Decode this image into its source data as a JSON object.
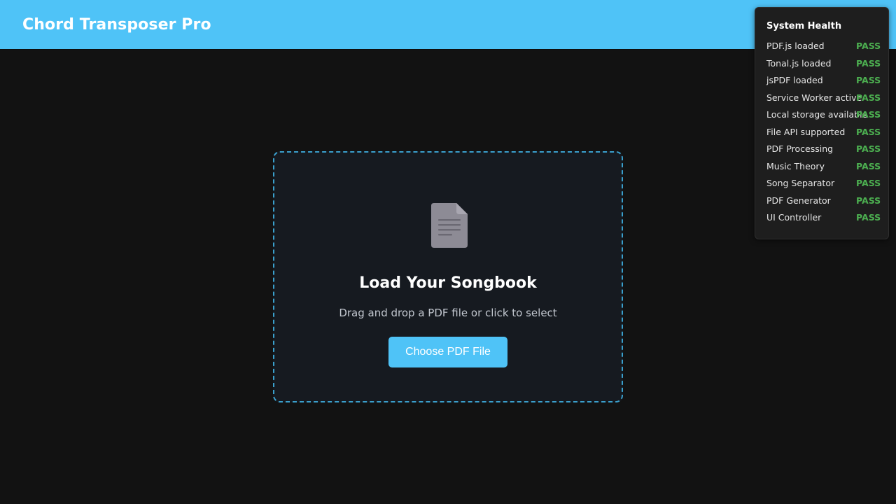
{
  "header": {
    "title": "Chord Transposer Pro"
  },
  "drop_zone": {
    "icon": "document-icon",
    "title": "Load Your Songbook",
    "subtitle": "Drag and drop a PDF file or click to select",
    "button_label": "Choose PDF File"
  },
  "health": {
    "title": "System Health",
    "items": [
      {
        "label": "PDF.js loaded",
        "status": "PASS"
      },
      {
        "label": "Tonal.js loaded",
        "status": "PASS"
      },
      {
        "label": "jsPDF loaded",
        "status": "PASS"
      },
      {
        "label": "Service Worker active",
        "status": "PASS"
      },
      {
        "label": "Local storage available",
        "status": "PASS"
      },
      {
        "label": "File API supported",
        "status": "PASS"
      },
      {
        "label": "PDF Processing",
        "status": "PASS"
      },
      {
        "label": "Music Theory",
        "status": "PASS"
      },
      {
        "label": "Song Separator",
        "status": "PASS"
      },
      {
        "label": "PDF Generator",
        "status": "PASS"
      },
      {
        "label": "UI Controller",
        "status": "PASS"
      }
    ]
  },
  "colors": {
    "accent": "#4fc3f7",
    "background": "#121212",
    "pass": "#4caf50",
    "dropzone_border": "#3a9fcc"
  }
}
